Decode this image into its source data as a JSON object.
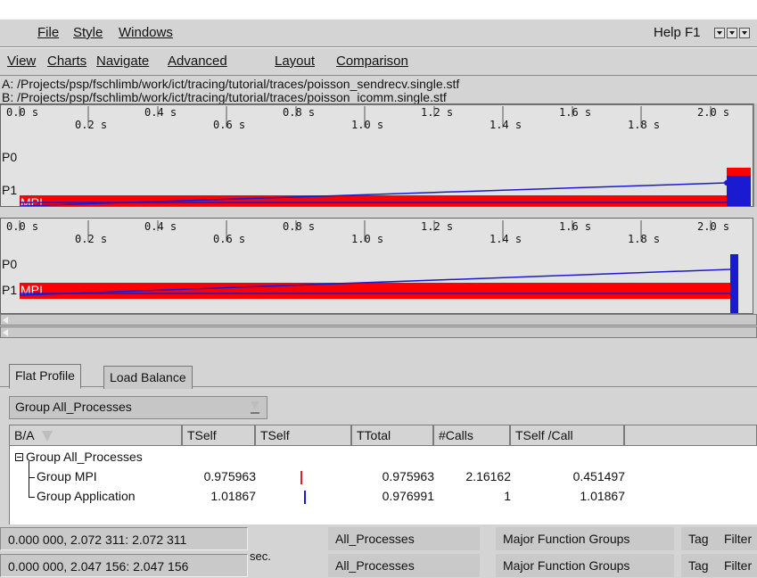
{
  "menus": {
    "primary": [
      "File",
      "Style",
      "Windows"
    ],
    "secondary": [
      "View",
      "Charts",
      "Navigate",
      "Advanced",
      "Layout",
      "Comparison"
    ],
    "help": "Help F1"
  },
  "trace_files": {
    "a": "A: /Projects/psp/fschlimb/work/ict/tracing/tutorial/traces/poisson_sendrecv.single.stf",
    "b": "B: /Projects/psp/fschlimb/work/ict/tracing/tutorial/traces/poisson_icomm.single.stf"
  },
  "timeline_ruler": {
    "upper_ticks": [
      "0.0 s",
      "0.4 s",
      "0.8 s",
      "1.2 s",
      "1.6 s",
      "2.0 s"
    ],
    "lower_ticks": [
      "0.2 s",
      "0.6 s",
      "1.0 s",
      "1.4 s",
      "1.8 s"
    ]
  },
  "timelines": [
    {
      "processes": [
        "P0",
        "P1"
      ],
      "mpi_label": "MPI",
      "end_seconds": 2.072311
    },
    {
      "processes": [
        "P0",
        "P1"
      ],
      "mpi_label": "MPI",
      "end_seconds": 2.047156
    }
  ],
  "colors": {
    "mpi": "#ff0000",
    "message_line": "#1a1ad0",
    "application": "#1a1ad0"
  },
  "tabs": [
    {
      "label": "Flat Profile",
      "active": true
    },
    {
      "label": "Load Balance",
      "active": false
    }
  ],
  "grouping": {
    "selected": "Group All_Processes"
  },
  "table": {
    "columns": [
      "B/A",
      "TSelf",
      "TSelf",
      "TTotal",
      "#Calls",
      "TSelf /Call"
    ],
    "root": "Group All_Processes",
    "rows": [
      {
        "name": "Group MPI",
        "tself": "0.975963",
        "ttotal": "0.975963",
        "calls": "2.16162",
        "tself_per_call": "0.451497",
        "bar_color": "#e02020"
      },
      {
        "name": "Group Application",
        "tself": "1.01867",
        "ttotal": "0.976991",
        "calls": "1",
        "tself_per_call": "1.01867",
        "bar_color": "#1a1ad0"
      }
    ]
  },
  "status": {
    "rows": [
      {
        "time_range": "0.000 000, 2.072 311: 2.072 311",
        "processes": "All_Processes",
        "functions": "Major Function Groups",
        "tag": "Tag",
        "filter": "Filter"
      },
      {
        "time_range": "0.000 000, 2.047 156: 2.047 156",
        "processes": "All_Processes",
        "functions": "Major Function Groups",
        "tag": "Tag",
        "filter": "Filter"
      }
    ],
    "unit": "sec."
  }
}
